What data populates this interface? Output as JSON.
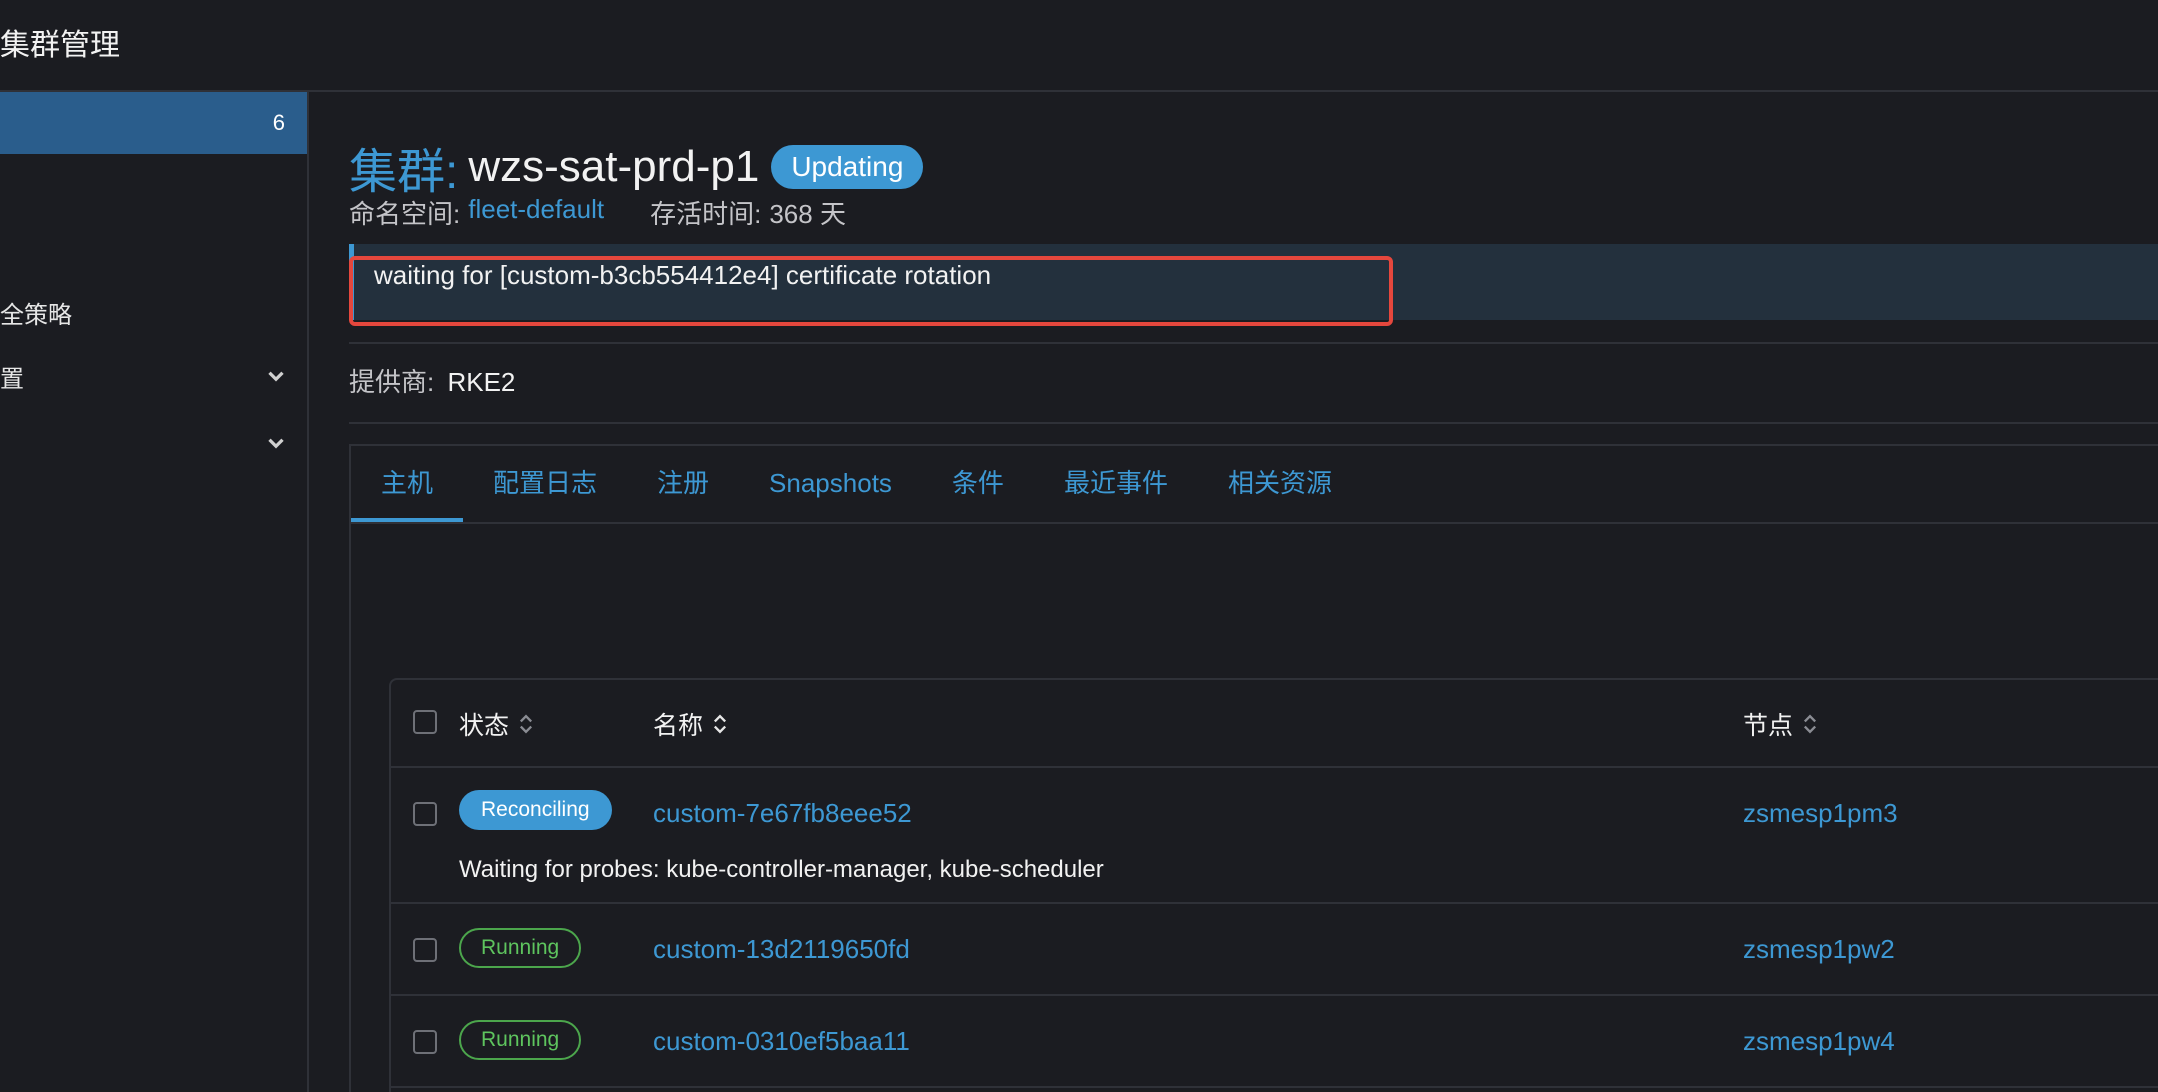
{
  "header": {
    "title": "集群管理"
  },
  "sidebar": {
    "active_count": "6",
    "items": [
      {
        "label": "全策略"
      },
      {
        "label": "置"
      },
      {
        "label": ""
      }
    ]
  },
  "cluster": {
    "prefix": "集群:",
    "name": "wzs-sat-prd-p1",
    "state": "Updating",
    "namespace_label": "命名空间:",
    "namespace_value": "fleet-default",
    "age_label": "存活时间:",
    "age_value": "368 天",
    "banner_message": "waiting for [custom-b3cb554412e4] certificate rotation",
    "provider_label": "提供商:",
    "provider_value": "RKE2"
  },
  "tabs": [
    {
      "label": "主机"
    },
    {
      "label": "配置日志"
    },
    {
      "label": "注册"
    },
    {
      "label": "Snapshots"
    },
    {
      "label": "条件"
    },
    {
      "label": "最近事件"
    },
    {
      "label": "相关资源"
    }
  ],
  "table": {
    "columns": {
      "state": "状态",
      "name": "名称",
      "node": "节点"
    },
    "rows": [
      {
        "state": "Reconciling",
        "name": "custom-7e67fb8eee52",
        "node": "zsmesp1pm3",
        "message": "Waiting for probes: kube-controller-manager, kube-scheduler"
      },
      {
        "state": "Running",
        "name": "custom-13d2119650fd",
        "node": "zsmesp1pw2"
      },
      {
        "state": "Running",
        "name": "custom-0310ef5baa11",
        "node": "zsmesp1pw4"
      }
    ]
  },
  "colors": {
    "accent": "#3d98d3",
    "running": "#4ca64c",
    "highlight": "#e5473d"
  }
}
